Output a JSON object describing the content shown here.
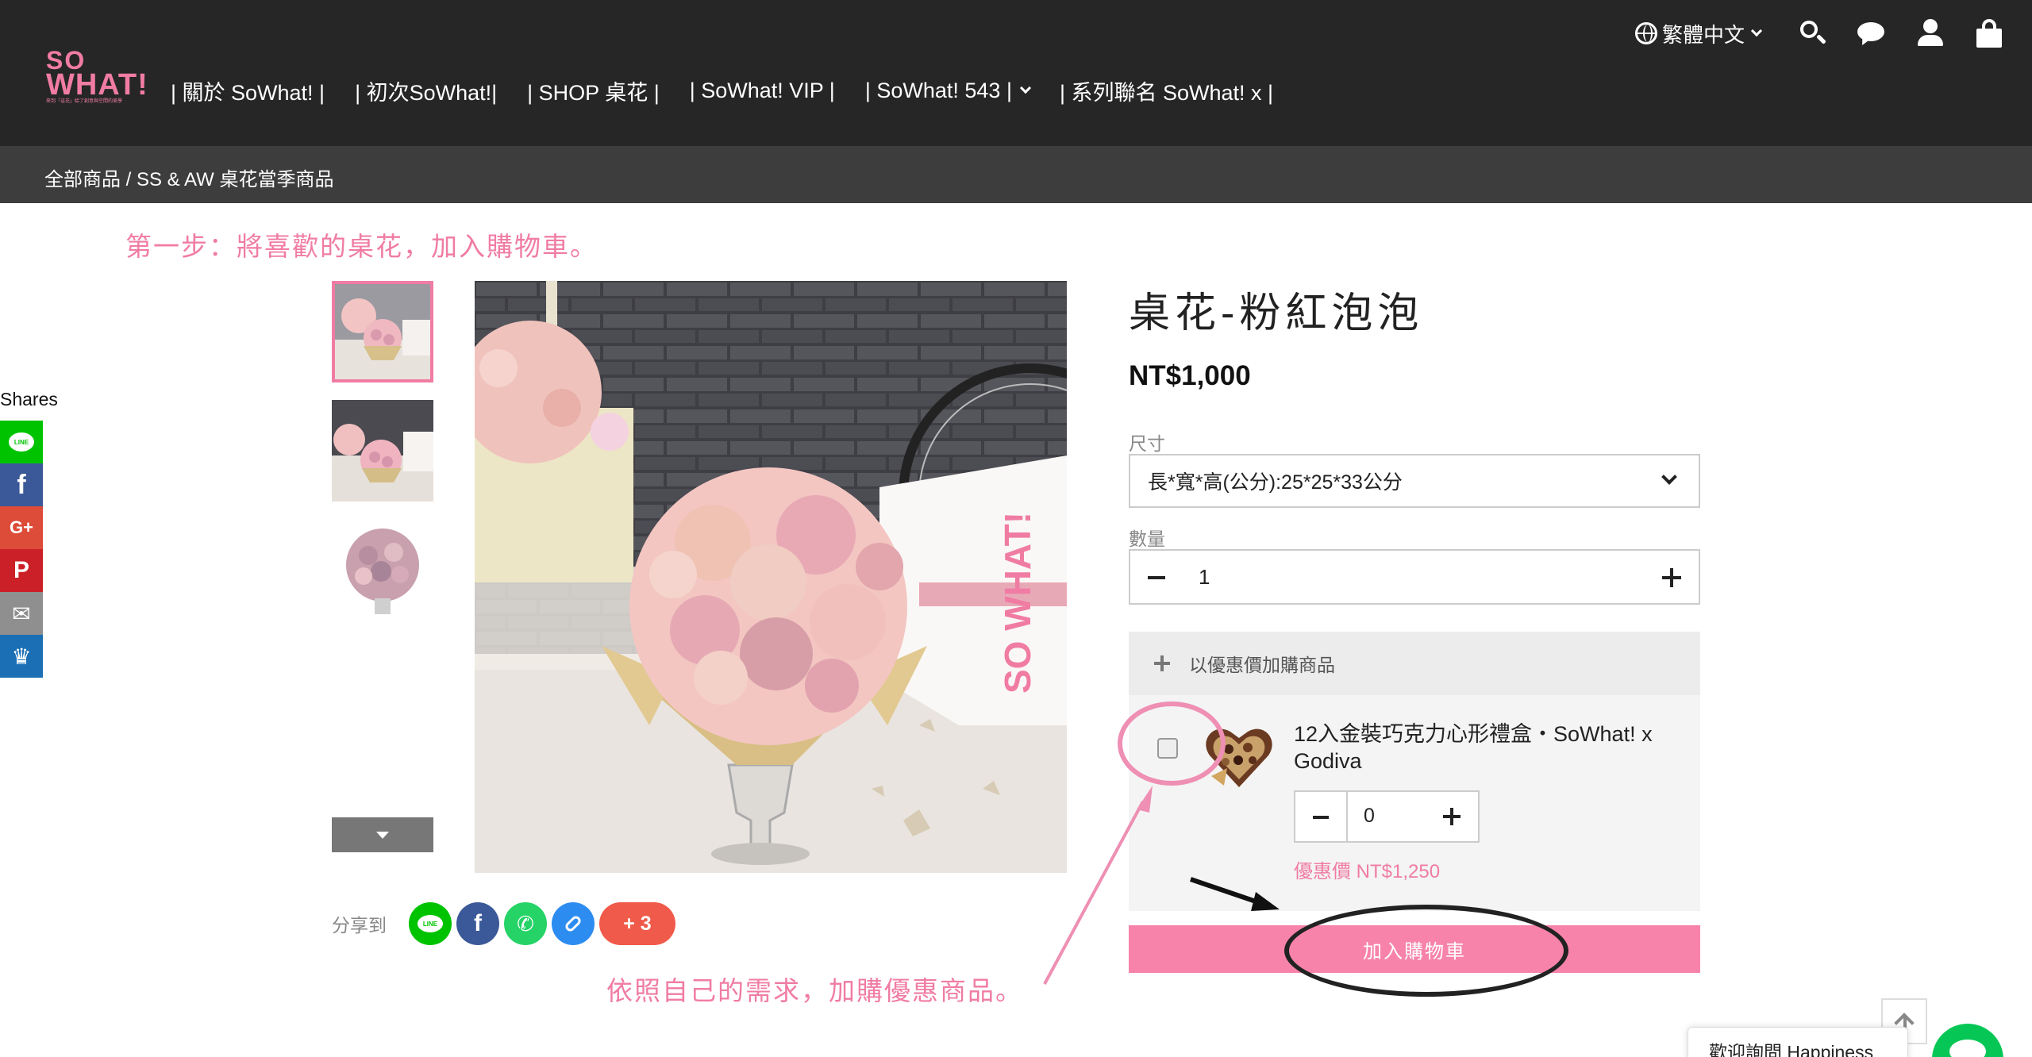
{
  "logo": {
    "line1": "SO",
    "line2": "WHAT!",
    "tagline": "來到「這花」給了創意與空間的美學"
  },
  "nav": {
    "items": [
      {
        "label": "| 關於 SoWhat! |"
      },
      {
        "label": "| 初次SoWhat!|"
      },
      {
        "label": "| SHOP 桌花 |"
      },
      {
        "label": "| SoWhat! VIP |"
      },
      {
        "label": "| SoWhat! 543 |"
      },
      {
        "label": "| 系列聯名 SoWhat! x |"
      }
    ],
    "language": "繁體中文"
  },
  "breadcrumb": "全部商品 / SS & AW 桌花當季商品",
  "annotations": {
    "step1": "第一步：將喜歡的桌花，加入購物車。",
    "step2": "依照自己的需求，加購優惠商品。"
  },
  "shares_sidebar": {
    "label": "Shares",
    "buttons": [
      {
        "name": "line",
        "glyph": "LINE",
        "color": "#00c300"
      },
      {
        "name": "facebook",
        "glyph": "f",
        "color": "#3b5998"
      },
      {
        "name": "google-plus",
        "glyph": "G+",
        "color": "#dd4b39"
      },
      {
        "name": "pinterest",
        "glyph": "P",
        "color": "#cb2027"
      },
      {
        "name": "email",
        "glyph": "✉",
        "color": "#8f8f8f"
      },
      {
        "name": "sumo-crown",
        "glyph": "♛",
        "color": "#1a6fb5"
      }
    ]
  },
  "share_to": {
    "label": "分享到",
    "buttons": [
      {
        "name": "line",
        "glyph": "LINE",
        "color": "#00c300"
      },
      {
        "name": "facebook",
        "glyph": "f",
        "color": "#3b5998"
      },
      {
        "name": "whatsapp",
        "glyph": "✆",
        "color": "#25d366"
      },
      {
        "name": "copy-link",
        "glyph": "🔗",
        "color": "#2d8cf0"
      }
    ],
    "more": "+ 3",
    "more_color": "#f05a4a"
  },
  "product": {
    "title": "桌花-粉紅泡泡",
    "price": "NT$1,000",
    "size_label": "尺寸",
    "size_value": "長*寬*高(公分):25*25*33公分",
    "qty_label": "數量",
    "qty_value": "1"
  },
  "addon": {
    "header": "以優惠價加購商品",
    "item_name": "12入金裝巧克力心形禮盒・SoWhat! x Godiva",
    "qty_value": "0",
    "price": "優惠價 NT$1,250"
  },
  "add_to_cart": "加入購物車",
  "chat_widget": "歡迎詢問 Happiness",
  "colors": {
    "accent_pink": "#f07ca4",
    "button_pink": "#f783ab",
    "header_dark": "#262626",
    "breadcrumb_bg": "#3d3d3d"
  }
}
